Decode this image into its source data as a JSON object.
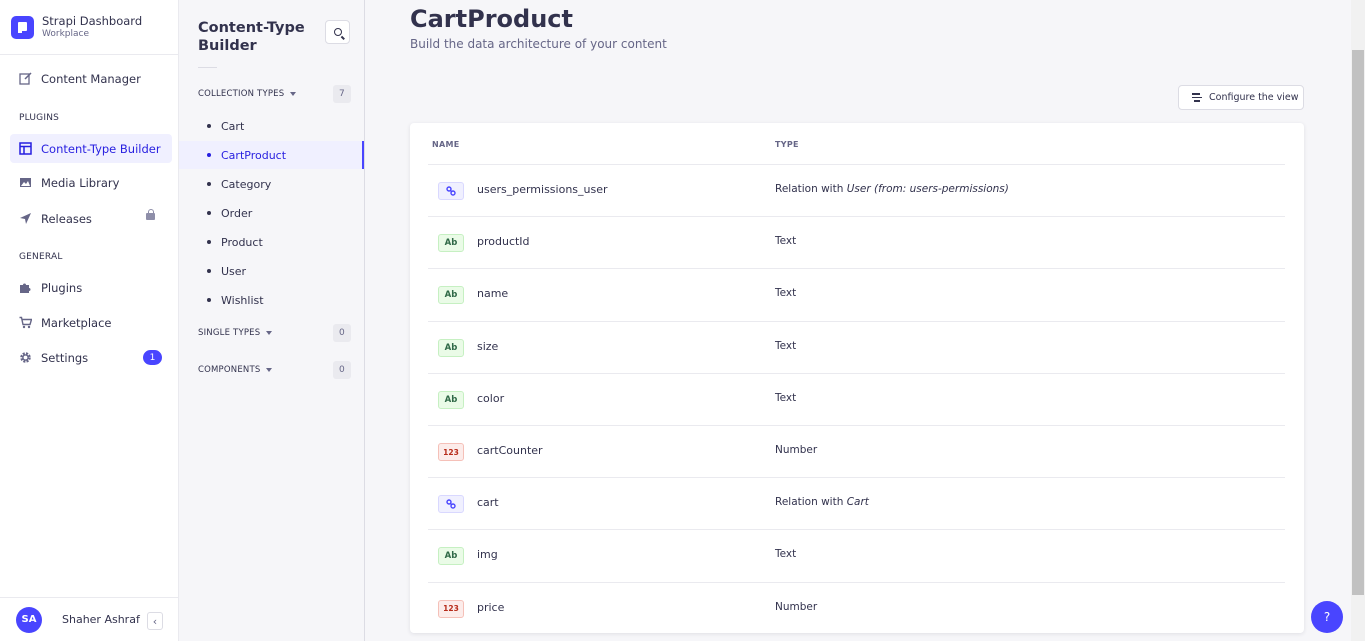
{
  "brand": {
    "title": "Strapi Dashboard",
    "subtitle": "Workplace"
  },
  "mainnav": {
    "content_manager": "Content Manager",
    "plugins_label": "PLUGINS",
    "content_type_builder": "Content-Type Builder",
    "media_library": "Media Library",
    "releases": "Releases",
    "general_label": "GENERAL",
    "plugins": "Plugins",
    "marketplace": "Marketplace",
    "settings": "Settings",
    "settings_badge": "1"
  },
  "user": {
    "initials": "SA",
    "name": "Shaher Ashraf"
  },
  "subnav": {
    "title": "Content-Type Builder",
    "collection_types": {
      "label": "COLLECTION TYPES",
      "count": "7"
    },
    "items": [
      "Cart",
      "CartProduct",
      "Category",
      "Order",
      "Product",
      "User",
      "Wishlist"
    ],
    "active_item": "CartProduct",
    "single_types": {
      "label": "SINGLE TYPES",
      "count": "0"
    },
    "components": {
      "label": "COMPONENTS",
      "count": "0"
    }
  },
  "page": {
    "title": "CartProduct",
    "subtitle": "Build the data architecture of your content",
    "configure_button": "Configure the view"
  },
  "table": {
    "headers": {
      "name": "NAME",
      "type": "TYPE"
    },
    "rows": [
      {
        "icon": "relation",
        "badge": "",
        "name": "users_permissions_user",
        "type_prefix": "Relation with ",
        "type_italic": "User (from: users-permissions)"
      },
      {
        "icon": "text",
        "badge": "Ab",
        "name": "productId",
        "type_prefix": "Text",
        "type_italic": ""
      },
      {
        "icon": "text",
        "badge": "Ab",
        "name": "name",
        "type_prefix": "Text",
        "type_italic": ""
      },
      {
        "icon": "text",
        "badge": "Ab",
        "name": "size",
        "type_prefix": "Text",
        "type_italic": ""
      },
      {
        "icon": "text",
        "badge": "Ab",
        "name": "color",
        "type_prefix": "Text",
        "type_italic": ""
      },
      {
        "icon": "number",
        "badge": "123",
        "name": "cartCounter",
        "type_prefix": "Number",
        "type_italic": ""
      },
      {
        "icon": "relation",
        "badge": "",
        "name": "cart",
        "type_prefix": "Relation with ",
        "type_italic": "Cart"
      },
      {
        "icon": "text",
        "badge": "Ab",
        "name": "img",
        "type_prefix": "Text",
        "type_italic": ""
      },
      {
        "icon": "number",
        "badge": "123",
        "name": "price",
        "type_prefix": "Number",
        "type_italic": ""
      }
    ]
  },
  "help": "?",
  "colors": {
    "primary": "#4945ff",
    "active_bg": "#f0f0ff",
    "text": "#32324d",
    "muted": "#666687"
  }
}
